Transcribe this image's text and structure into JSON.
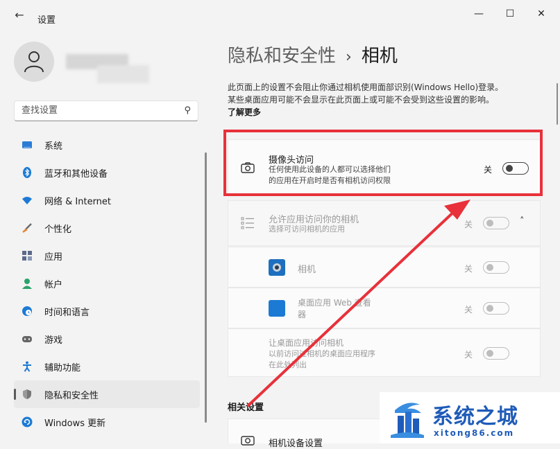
{
  "window": {
    "title": "设置",
    "back_icon": "back-arrow-icon",
    "minimize_glyph": "—",
    "maximize_glyph": "☐",
    "close_glyph": "✕"
  },
  "search": {
    "placeholder": "查找设置",
    "icon": "search-icon"
  },
  "sidebar": {
    "items": [
      {
        "label": "系统",
        "icon": "system-icon",
        "color": "#2b7bd6"
      },
      {
        "label": "蓝牙和其他设备",
        "icon": "bluetooth-icon",
        "color": "#1c7ad4"
      },
      {
        "label": "网络 & Internet",
        "icon": "wifi-icon",
        "color": "#1c7ad4"
      },
      {
        "label": "个性化",
        "icon": "brush-icon",
        "color": "#e2893a"
      },
      {
        "label": "应用",
        "icon": "apps-icon",
        "color": "#5a6b8a"
      },
      {
        "label": "帐户",
        "icon": "account-icon",
        "color": "#2aa36b"
      },
      {
        "label": "时间和语言",
        "icon": "time-language-icon",
        "color": "#1c7ad4"
      },
      {
        "label": "游戏",
        "icon": "gaming-icon",
        "color": "#666666"
      },
      {
        "label": "辅助功能",
        "icon": "accessibility-icon",
        "color": "#1c7ad4"
      },
      {
        "label": "隐私和安全性",
        "icon": "shield-icon",
        "color": "#666666",
        "selected": true
      },
      {
        "label": "Windows 更新",
        "icon": "windows-update-icon",
        "color": "#1c7ad4"
      }
    ]
  },
  "main": {
    "breadcrumb_parent": "隐私和安全性",
    "breadcrumb_sep": "›",
    "breadcrumb_current": "相机",
    "description_line1": "此页面上的设置不会阻止你通过相机使用面部识别(Windows Hello)登录。",
    "description_line2": "某些桌面应用可能不会显示在此页面上或可能不会受到这些设置的影响。",
    "learn_more": "了解更多",
    "camera_access": {
      "title": "摄像头访问",
      "sub1": "任何使用此设备的人都可以选择他们",
      "sub2": "的应用在开启时是否有相机访问权限",
      "state": "关",
      "icon": "camera-icon"
    },
    "allow_apps": {
      "title": "允许应用访问你的相机",
      "sub": "选择可访问相机的应用",
      "state": "关",
      "icon": "list-icon",
      "chevron": "˄"
    },
    "apps": [
      {
        "name": "相机",
        "state": "关",
        "icon": "camera-app-icon"
      },
      {
        "name_line1": "桌面应用 Web 查看",
        "name_line2": "器",
        "state": "关",
        "icon": "webview-app-icon"
      }
    ],
    "desktop_apps": {
      "title": "让桌面应用访问相机",
      "sub1": "以前访问过相机的桌面应用程序",
      "sub2": "在此处列出",
      "state": "关"
    },
    "related_title": "相关设置",
    "related_item": "相机设备设置"
  },
  "annotation": {
    "color": "#e8313a"
  },
  "watermark": {
    "title": "系统之城",
    "url": "xitong86.com",
    "color": "#1f5bb8"
  }
}
